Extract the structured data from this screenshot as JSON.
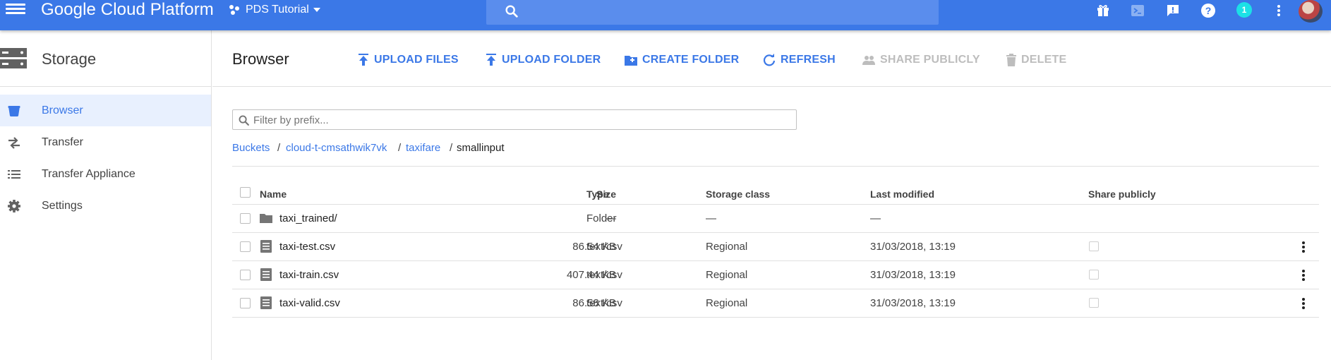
{
  "topbar": {
    "brand": "Google Cloud Platform",
    "project": "PDS Tutorial",
    "notification_count": "1",
    "icons": [
      "gift-icon",
      "cloud-shell-icon",
      "feedback-icon",
      "help-icon",
      "notifications-badge",
      "more-vert-icon",
      "avatar"
    ],
    "accent_color": "#3b78e7"
  },
  "sidebar": {
    "title": "Storage",
    "items": [
      {
        "label": "Browser",
        "icon": "bucket-icon",
        "active": true
      },
      {
        "label": "Transfer",
        "icon": "transfer-icon",
        "active": false
      },
      {
        "label": "Transfer Appliance",
        "icon": "list-icon",
        "active": false
      },
      {
        "label": "Settings",
        "icon": "gear-icon",
        "active": false
      }
    ]
  },
  "main": {
    "title": "Browser",
    "actions": {
      "upload_files": "UPLOAD FILES",
      "upload_folder": "UPLOAD FOLDER",
      "create_folder": "CREATE FOLDER",
      "refresh": "REFRESH",
      "share_publicly": "SHARE PUBLICLY",
      "delete": "DELETE"
    },
    "filter": {
      "placeholder": "Filter by prefix...",
      "value": ""
    },
    "breadcrumb": {
      "items": [
        "Buckets",
        "cloud-t-cmsathwik7vk",
        "taxifare",
        "smallinput"
      ],
      "separator": "/"
    },
    "table": {
      "columns": [
        "Name",
        "Size",
        "Type",
        "Storage class",
        "Last modified",
        "Share publicly"
      ],
      "rows": [
        {
          "name": "taxi_trained/",
          "size": "—",
          "type": "Folder",
          "storage_class": "—",
          "modified": "—",
          "kind": "folder"
        },
        {
          "name": "taxi-test.csv",
          "size": "86.54 KB",
          "type": "text/csv",
          "storage_class": "Regional",
          "modified": "31/03/2018, 13:19",
          "kind": "file"
        },
        {
          "name": "taxi-train.csv",
          "size": "407.44 KB",
          "type": "text/csv",
          "storage_class": "Regional",
          "modified": "31/03/2018, 13:19",
          "kind": "file"
        },
        {
          "name": "taxi-valid.csv",
          "size": "86.58 KB",
          "type": "text/csv",
          "storage_class": "Regional",
          "modified": "31/03/2018, 13:19",
          "kind": "file"
        }
      ]
    }
  }
}
